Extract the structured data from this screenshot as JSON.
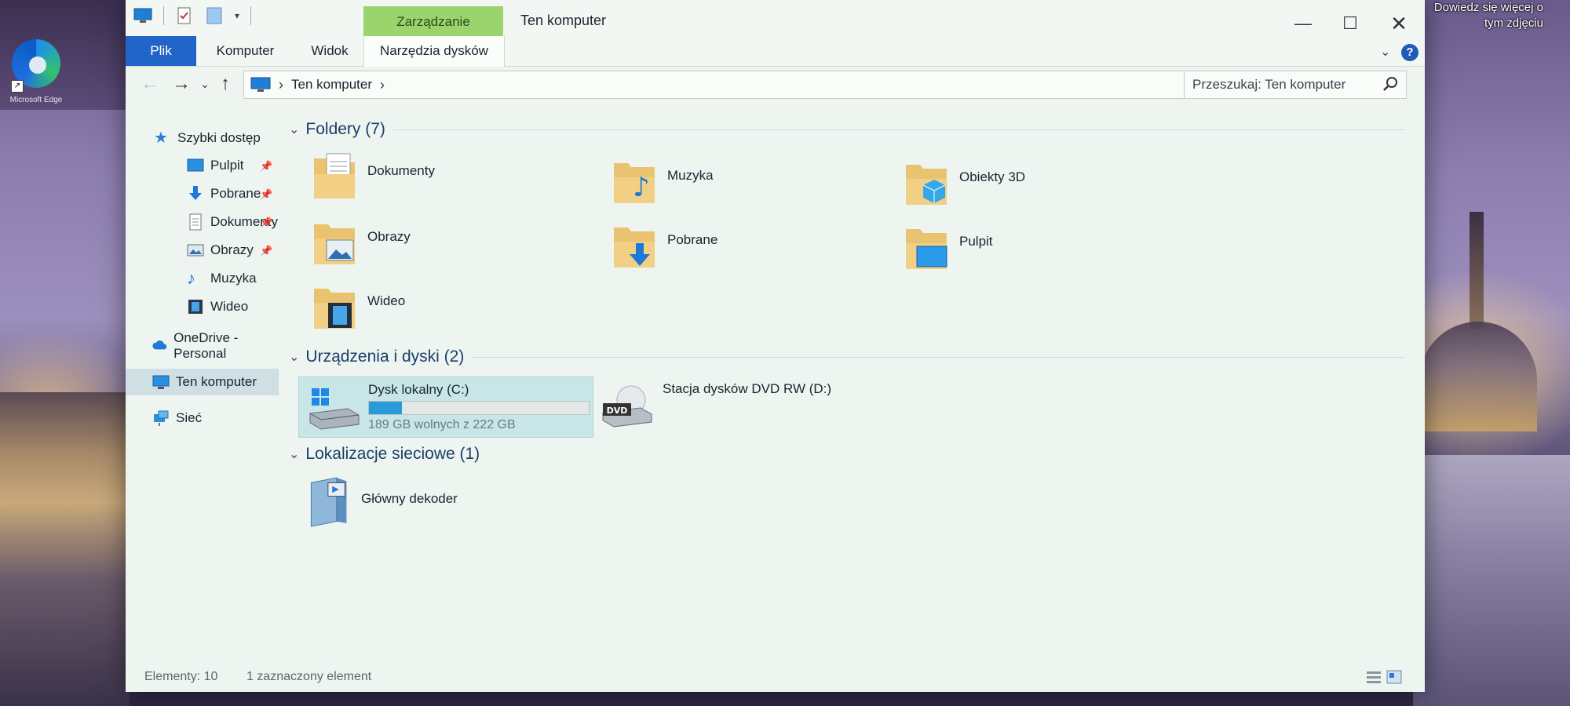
{
  "desktop": {
    "tooltip_line1": "Dowiedz się więcej o",
    "tooltip_line2": "tym zdjęciu",
    "edge_label": "Microsoft Edge"
  },
  "window": {
    "title": "Ten komputer",
    "context_tab_header": "Zarządzanie",
    "minimize": "—",
    "maximize": "☐",
    "close": "✕"
  },
  "ribbon": {
    "tabs": [
      "Plik",
      "Komputer",
      "Widok",
      "Narzędzia dysków"
    ],
    "collapse_glyph": "⌄",
    "help_glyph": "?"
  },
  "navigation": {
    "back": "←",
    "forward": "→",
    "recent": "⌄",
    "up": "↑",
    "address_location": "Ten komputer",
    "address_separator": "›",
    "address_trailing_separator": "›",
    "search_placeholder": "Przeszukaj: Ten komputer"
  },
  "sidebar": {
    "quick_access": "Szybki dostęp",
    "items": [
      {
        "label": "Pulpit",
        "pinned": true
      },
      {
        "label": "Pobrane",
        "pinned": true
      },
      {
        "label": "Dokumenty",
        "pinned": true
      },
      {
        "label": "Obrazy",
        "pinned": true
      },
      {
        "label": "Muzyka",
        "pinned": false
      },
      {
        "label": "Wideo",
        "pinned": false
      }
    ],
    "onedrive": "OneDrive - Personal",
    "this_pc": "Ten komputer",
    "network": "Sieć"
  },
  "content": {
    "folders_header": "Foldery (7)",
    "folders": [
      {
        "label": "Dokumenty",
        "icon": "documents-folder-icon"
      },
      {
        "label": "Muzyka",
        "icon": "music-folder-icon"
      },
      {
        "label": "Obiekty 3D",
        "icon": "3d-objects-folder-icon"
      },
      {
        "label": "Obrazy",
        "icon": "pictures-folder-icon"
      },
      {
        "label": "Pobrane",
        "icon": "downloads-folder-icon"
      },
      {
        "label": "Pulpit",
        "icon": "desktop-folder-icon"
      },
      {
        "label": "Wideo",
        "icon": "videos-folder-icon"
      }
    ],
    "devices_header": "Urządzenia i dyski (2)",
    "drives": [
      {
        "name": "Dysk lokalny (C:)",
        "free": "189 GB wolnych z 222 GB",
        "used_fraction": 0.149,
        "selected": true
      },
      {
        "name": "Stacja dysków DVD RW (D:)",
        "badge": "DVD",
        "selected": false
      }
    ],
    "network_header": "Lokalizacje sieciowe (1)",
    "network_locations": [
      {
        "label": "Główny dekoder"
      }
    ]
  },
  "status": {
    "count": "Elementy: 10",
    "selected": "1 zaznaczony element"
  },
  "colors": {
    "ribbon_file_tab": "#2265c8",
    "context_tab": "#9bd36c",
    "selection": "#c9e6e6",
    "drive_bar": "#2a9ad8",
    "folder": "#e9c370"
  }
}
